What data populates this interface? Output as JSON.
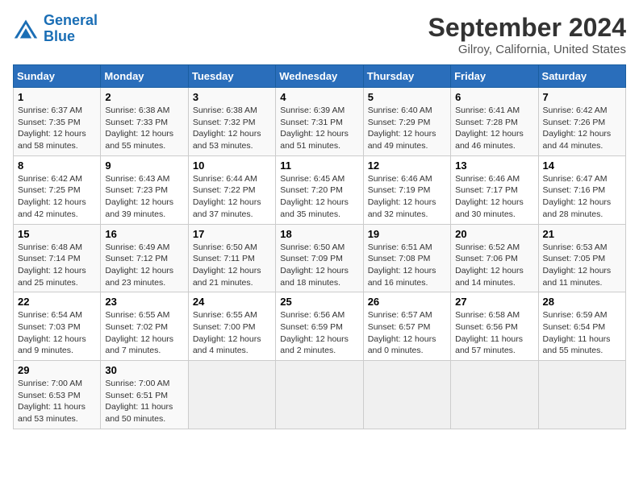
{
  "header": {
    "logo_line1": "General",
    "logo_line2": "Blue",
    "title": "September 2024",
    "subtitle": "Gilroy, California, United States"
  },
  "columns": [
    "Sunday",
    "Monday",
    "Tuesday",
    "Wednesday",
    "Thursday",
    "Friday",
    "Saturday"
  ],
  "rows": [
    [
      {
        "day": "1",
        "text": "Sunrise: 6:37 AM\nSunset: 7:35 PM\nDaylight: 12 hours\nand 58 minutes."
      },
      {
        "day": "2",
        "text": "Sunrise: 6:38 AM\nSunset: 7:33 PM\nDaylight: 12 hours\nand 55 minutes."
      },
      {
        "day": "3",
        "text": "Sunrise: 6:38 AM\nSunset: 7:32 PM\nDaylight: 12 hours\nand 53 minutes."
      },
      {
        "day": "4",
        "text": "Sunrise: 6:39 AM\nSunset: 7:31 PM\nDaylight: 12 hours\nand 51 minutes."
      },
      {
        "day": "5",
        "text": "Sunrise: 6:40 AM\nSunset: 7:29 PM\nDaylight: 12 hours\nand 49 minutes."
      },
      {
        "day": "6",
        "text": "Sunrise: 6:41 AM\nSunset: 7:28 PM\nDaylight: 12 hours\nand 46 minutes."
      },
      {
        "day": "7",
        "text": "Sunrise: 6:42 AM\nSunset: 7:26 PM\nDaylight: 12 hours\nand 44 minutes."
      }
    ],
    [
      {
        "day": "8",
        "text": "Sunrise: 6:42 AM\nSunset: 7:25 PM\nDaylight: 12 hours\nand 42 minutes."
      },
      {
        "day": "9",
        "text": "Sunrise: 6:43 AM\nSunset: 7:23 PM\nDaylight: 12 hours\nand 39 minutes."
      },
      {
        "day": "10",
        "text": "Sunrise: 6:44 AM\nSunset: 7:22 PM\nDaylight: 12 hours\nand 37 minutes."
      },
      {
        "day": "11",
        "text": "Sunrise: 6:45 AM\nSunset: 7:20 PM\nDaylight: 12 hours\nand 35 minutes."
      },
      {
        "day": "12",
        "text": "Sunrise: 6:46 AM\nSunset: 7:19 PM\nDaylight: 12 hours\nand 32 minutes."
      },
      {
        "day": "13",
        "text": "Sunrise: 6:46 AM\nSunset: 7:17 PM\nDaylight: 12 hours\nand 30 minutes."
      },
      {
        "day": "14",
        "text": "Sunrise: 6:47 AM\nSunset: 7:16 PM\nDaylight: 12 hours\nand 28 minutes."
      }
    ],
    [
      {
        "day": "15",
        "text": "Sunrise: 6:48 AM\nSunset: 7:14 PM\nDaylight: 12 hours\nand 25 minutes."
      },
      {
        "day": "16",
        "text": "Sunrise: 6:49 AM\nSunset: 7:12 PM\nDaylight: 12 hours\nand 23 minutes."
      },
      {
        "day": "17",
        "text": "Sunrise: 6:50 AM\nSunset: 7:11 PM\nDaylight: 12 hours\nand 21 minutes."
      },
      {
        "day": "18",
        "text": "Sunrise: 6:50 AM\nSunset: 7:09 PM\nDaylight: 12 hours\nand 18 minutes."
      },
      {
        "day": "19",
        "text": "Sunrise: 6:51 AM\nSunset: 7:08 PM\nDaylight: 12 hours\nand 16 minutes."
      },
      {
        "day": "20",
        "text": "Sunrise: 6:52 AM\nSunset: 7:06 PM\nDaylight: 12 hours\nand 14 minutes."
      },
      {
        "day": "21",
        "text": "Sunrise: 6:53 AM\nSunset: 7:05 PM\nDaylight: 12 hours\nand 11 minutes."
      }
    ],
    [
      {
        "day": "22",
        "text": "Sunrise: 6:54 AM\nSunset: 7:03 PM\nDaylight: 12 hours\nand 9 minutes."
      },
      {
        "day": "23",
        "text": "Sunrise: 6:55 AM\nSunset: 7:02 PM\nDaylight: 12 hours\nand 7 minutes."
      },
      {
        "day": "24",
        "text": "Sunrise: 6:55 AM\nSunset: 7:00 PM\nDaylight: 12 hours\nand 4 minutes."
      },
      {
        "day": "25",
        "text": "Sunrise: 6:56 AM\nSunset: 6:59 PM\nDaylight: 12 hours\nand 2 minutes."
      },
      {
        "day": "26",
        "text": "Sunrise: 6:57 AM\nSunset: 6:57 PM\nDaylight: 12 hours\nand 0 minutes."
      },
      {
        "day": "27",
        "text": "Sunrise: 6:58 AM\nSunset: 6:56 PM\nDaylight: 11 hours\nand 57 minutes."
      },
      {
        "day": "28",
        "text": "Sunrise: 6:59 AM\nSunset: 6:54 PM\nDaylight: 11 hours\nand 55 minutes."
      }
    ],
    [
      {
        "day": "29",
        "text": "Sunrise: 7:00 AM\nSunset: 6:53 PM\nDaylight: 11 hours\nand 53 minutes."
      },
      {
        "day": "30",
        "text": "Sunrise: 7:00 AM\nSunset: 6:51 PM\nDaylight: 11 hours\nand 50 minutes."
      },
      {
        "day": "",
        "text": ""
      },
      {
        "day": "",
        "text": ""
      },
      {
        "day": "",
        "text": ""
      },
      {
        "day": "",
        "text": ""
      },
      {
        "day": "",
        "text": ""
      }
    ]
  ]
}
